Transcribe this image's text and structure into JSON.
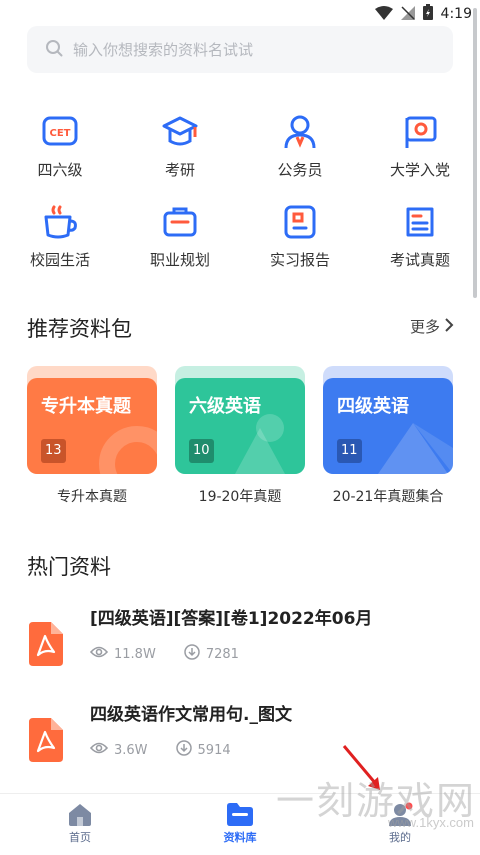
{
  "status": {
    "time": "4:19"
  },
  "search": {
    "placeholder": "输入你想搜索的资料名试试"
  },
  "categories": [
    {
      "label": "四六级",
      "icon": "cet-icon"
    },
    {
      "label": "考研",
      "icon": "graduation-cap-icon"
    },
    {
      "label": "公务员",
      "icon": "civil-servant-icon"
    },
    {
      "label": "大学入党",
      "icon": "party-flag-icon"
    },
    {
      "label": "校园生活",
      "icon": "coffee-cup-icon"
    },
    {
      "label": "职业规划",
      "icon": "briefcase-icon"
    },
    {
      "label": "实习报告",
      "icon": "report-card-icon"
    },
    {
      "label": "考试真题",
      "icon": "exam-paper-icon"
    }
  ],
  "recommended": {
    "title": "推荐资料包",
    "more": "更多",
    "packs": [
      {
        "title": "专升本真题",
        "count": "13",
        "label": "专升本真题",
        "color": "#ff7a45",
        "back": "#ffd9c7",
        "badge": "#c9542a"
      },
      {
        "title": "六级英语",
        "count": "10",
        "label": "19-20年真题",
        "color": "#2ec59a",
        "back": "#c6efe2",
        "badge": "#1f8d6d"
      },
      {
        "title": "四级英语",
        "count": "11",
        "label": "20-21年真题集合",
        "color": "#3d7bf0",
        "back": "#cfdcfb",
        "badge": "#2a58b3"
      }
    ]
  },
  "hot": {
    "title": "热门资料",
    "docs": [
      {
        "title": "[四级英语][答案][卷1]2022年06月",
        "views": "11.8W",
        "downloads": "7281"
      },
      {
        "title": "四级英语作文常用句._图文",
        "views": "3.6W",
        "downloads": "5914"
      }
    ]
  },
  "tabs": [
    {
      "label": "首页",
      "color": "#5b6b8c"
    },
    {
      "label": "资料库",
      "color": "#2d6cf6"
    },
    {
      "label": "我的",
      "color": "#5b6b8c"
    }
  ],
  "watermark": {
    "text": "一刻游戏网",
    "url": "www.1kyx.com"
  }
}
